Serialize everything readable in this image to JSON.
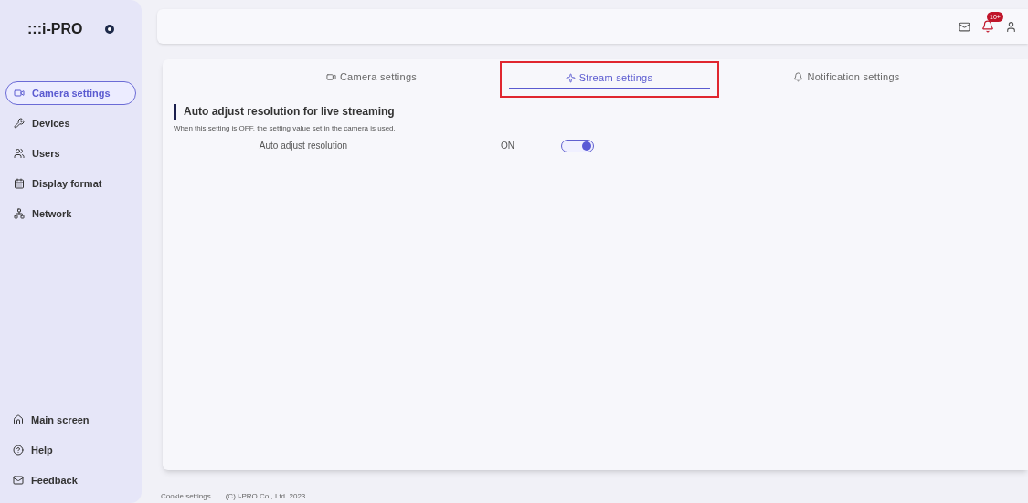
{
  "sidebar": {
    "logo": ":::i-PRO",
    "items": [
      {
        "label": "Camera settings",
        "selected": true
      },
      {
        "label": "Devices",
        "selected": false
      },
      {
        "label": "Users",
        "selected": false
      },
      {
        "label": "Display format",
        "selected": false
      },
      {
        "label": "Network",
        "selected": false
      }
    ],
    "bottom_items": [
      {
        "label": "Main screen"
      },
      {
        "label": "Help"
      },
      {
        "label": "Feedback"
      }
    ]
  },
  "header": {
    "notification_badge": "10+"
  },
  "tabs": [
    {
      "label": "Camera settings",
      "selected": false,
      "highlighted": false
    },
    {
      "label": "Stream settings",
      "selected": true,
      "highlighted": true
    },
    {
      "label": "Notification settings",
      "selected": false,
      "highlighted": false
    }
  ],
  "section": {
    "title": "Auto adjust resolution for live streaming",
    "description": "When this setting is OFF, the setting value set in the camera is used.",
    "settings": [
      {
        "label": "Auto adjust resolution",
        "value": "ON",
        "on": true
      }
    ]
  },
  "footer": {
    "links": [
      "Cookie settings"
    ],
    "copyright": "(C) i-PRO Co., Ltd. 2023"
  }
}
